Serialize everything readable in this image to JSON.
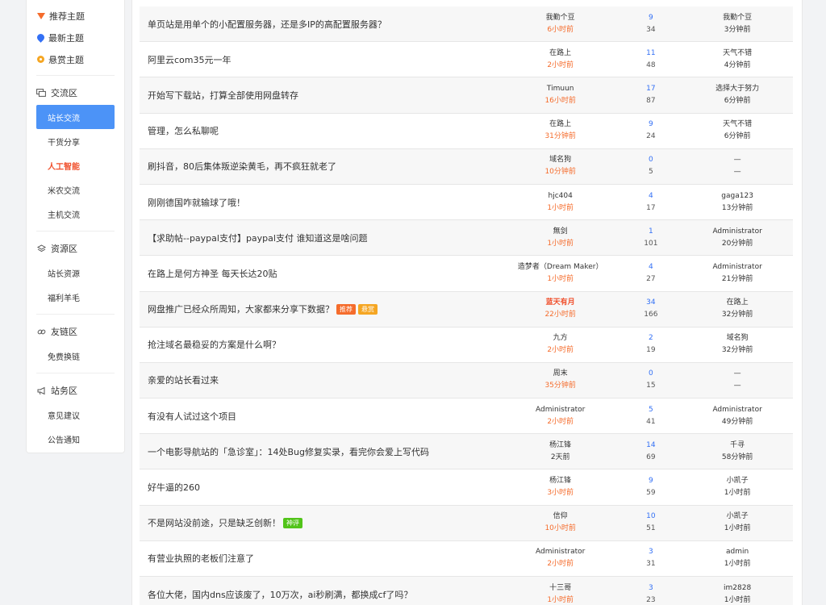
{
  "sidebar": {
    "top": [
      {
        "label": "推荐主题",
        "icon": "hot-icon"
      },
      {
        "label": "最新主题",
        "icon": "drop-icon"
      },
      {
        "label": "悬赏主题",
        "icon": "coin-icon"
      }
    ],
    "sections": [
      {
        "label": "交流区",
        "icon": "chat-icon",
        "items": [
          "站长交流",
          "干货分享",
          "人工智能",
          "米农交流",
          "主机交流"
        ]
      },
      {
        "label": "资源区",
        "icon": "layers-icon",
        "items": [
          "站长资源",
          "福利羊毛"
        ]
      },
      {
        "label": "友链区",
        "icon": "link-icon",
        "items": [
          "免费换链"
        ]
      },
      {
        "label": "站务区",
        "icon": "megaphone-icon",
        "items": [
          "意见建议",
          "公告通知"
        ]
      }
    ]
  },
  "threads": [
    {
      "title": "单页站是用单个的小配置服务器，还是多IP的高配置服务器？",
      "author": "我勤个豆",
      "time": "6小时前",
      "replies": "9",
      "views": "34",
      "last_user": "我勤个豆",
      "last_time": "3分钟前"
    },
    {
      "title": "阿里云com35元一年",
      "author": "在路上",
      "time": "2小时前",
      "replies": "11",
      "views": "48",
      "last_user": "天气不错",
      "last_time": "4分钟前"
    },
    {
      "title": "开始写下载站，打算全部使用网盘转存",
      "author": "Timuun",
      "time": "16小时前",
      "replies": "17",
      "views": "87",
      "last_user": "选择大于努力",
      "last_time": "6分钟前"
    },
    {
      "title": "管理，怎么私聊呢",
      "author": "在路上",
      "time": "31分钟前",
      "replies": "9",
      "views": "24",
      "last_user": "天气不错",
      "last_time": "6分钟前"
    },
    {
      "title": "刷抖音，80后集体叛逆染黄毛，再不疯狂就老了",
      "author": "域名狗",
      "time": "10分钟前",
      "replies": "0",
      "views": "5",
      "last_user": "—",
      "last_time": "—"
    },
    {
      "title": "刚刚德国咋就输球了哦！",
      "author": "hjc404",
      "time": "1小时前",
      "replies": "4",
      "views": "17",
      "last_user": "gaga123",
      "last_time": "13分钟前"
    },
    {
      "title": "【求助帖--paypal支付】paypal支付 谁知道这是啥问题",
      "author": "無剑",
      "time": "1小时前",
      "replies": "1",
      "views": "101",
      "last_user": "Administrator",
      "last_time": "20分钟前"
    },
    {
      "title": "在路上是何方神圣 每天长达20贴",
      "author": "造梦者（Dream Maker）",
      "time": "1小时前",
      "replies": "4",
      "views": "27",
      "last_user": "Administrator",
      "last_time": "21分钟前"
    },
    {
      "title": "网盘推广已经众所周知，大家都来分享下数据？",
      "tags": [
        {
          "text": "推荐",
          "color": "#f56c2c"
        },
        {
          "text": "悬赏",
          "color": "#f5a623"
        }
      ],
      "author": "蓝天有月",
      "author_highlight": true,
      "time": "22小时前",
      "replies": "34",
      "views": "166",
      "last_user": "在路上",
      "last_time": "32分钟前"
    },
    {
      "title": "抢注域名最稳妥的方案是什么啊？",
      "author": "九方",
      "time": "2小时前",
      "replies": "2",
      "views": "19",
      "last_user": "域名狗",
      "last_time": "32分钟前"
    },
    {
      "title": "亲爱的站长看过来",
      "author": "周末",
      "time": "35分钟前",
      "replies": "0",
      "views": "15",
      "last_user": "—",
      "last_time": "—"
    },
    {
      "title": "有没有人试过这个项目",
      "author": "Administrator",
      "time": "2小时前",
      "replies": "5",
      "views": "41",
      "last_user": "Administrator",
      "last_time": "49分钟前"
    },
    {
      "title": "一个电影导航站的「急诊室」：14处Bug修复实录，看完你会爱上写代码",
      "author": "杨江锋",
      "time": "2天前",
      "time_plain": true,
      "replies": "14",
      "views": "69",
      "last_user": "千寻",
      "last_time": "58分钟前"
    },
    {
      "title": "好牛逼的260",
      "author": "杨江锋",
      "time": "3小时前",
      "replies": "9",
      "views": "59",
      "last_user": "小凯子",
      "last_time": "1小时前"
    },
    {
      "title": "不是网站没前途，只是缺乏创新！",
      "tags": [
        {
          "text": "神评",
          "color": "#52c41a"
        }
      ],
      "author": "信仰",
      "time": "10小时前",
      "replies": "10",
      "views": "51",
      "last_user": "小凯子",
      "last_time": "1小时前"
    },
    {
      "title": "有营业执照的老板们注意了",
      "author": "Administrator",
      "time": "2小时前",
      "replies": "3",
      "views": "31",
      "last_user": "admin",
      "last_time": "1小时前"
    },
    {
      "title": "各位大佬，国内dns应该废了，10万次，ai秒刷满，都换成cf了吗？",
      "author": "十三哥",
      "time": "1小时前",
      "replies": "3",
      "views": "23",
      "last_user": "im2828",
      "last_time": "1小时前"
    }
  ],
  "colors": {
    "accent": "#4c93f7",
    "hot": "#f0502d",
    "time": "#f56c2c",
    "reply": "#3370f5"
  }
}
